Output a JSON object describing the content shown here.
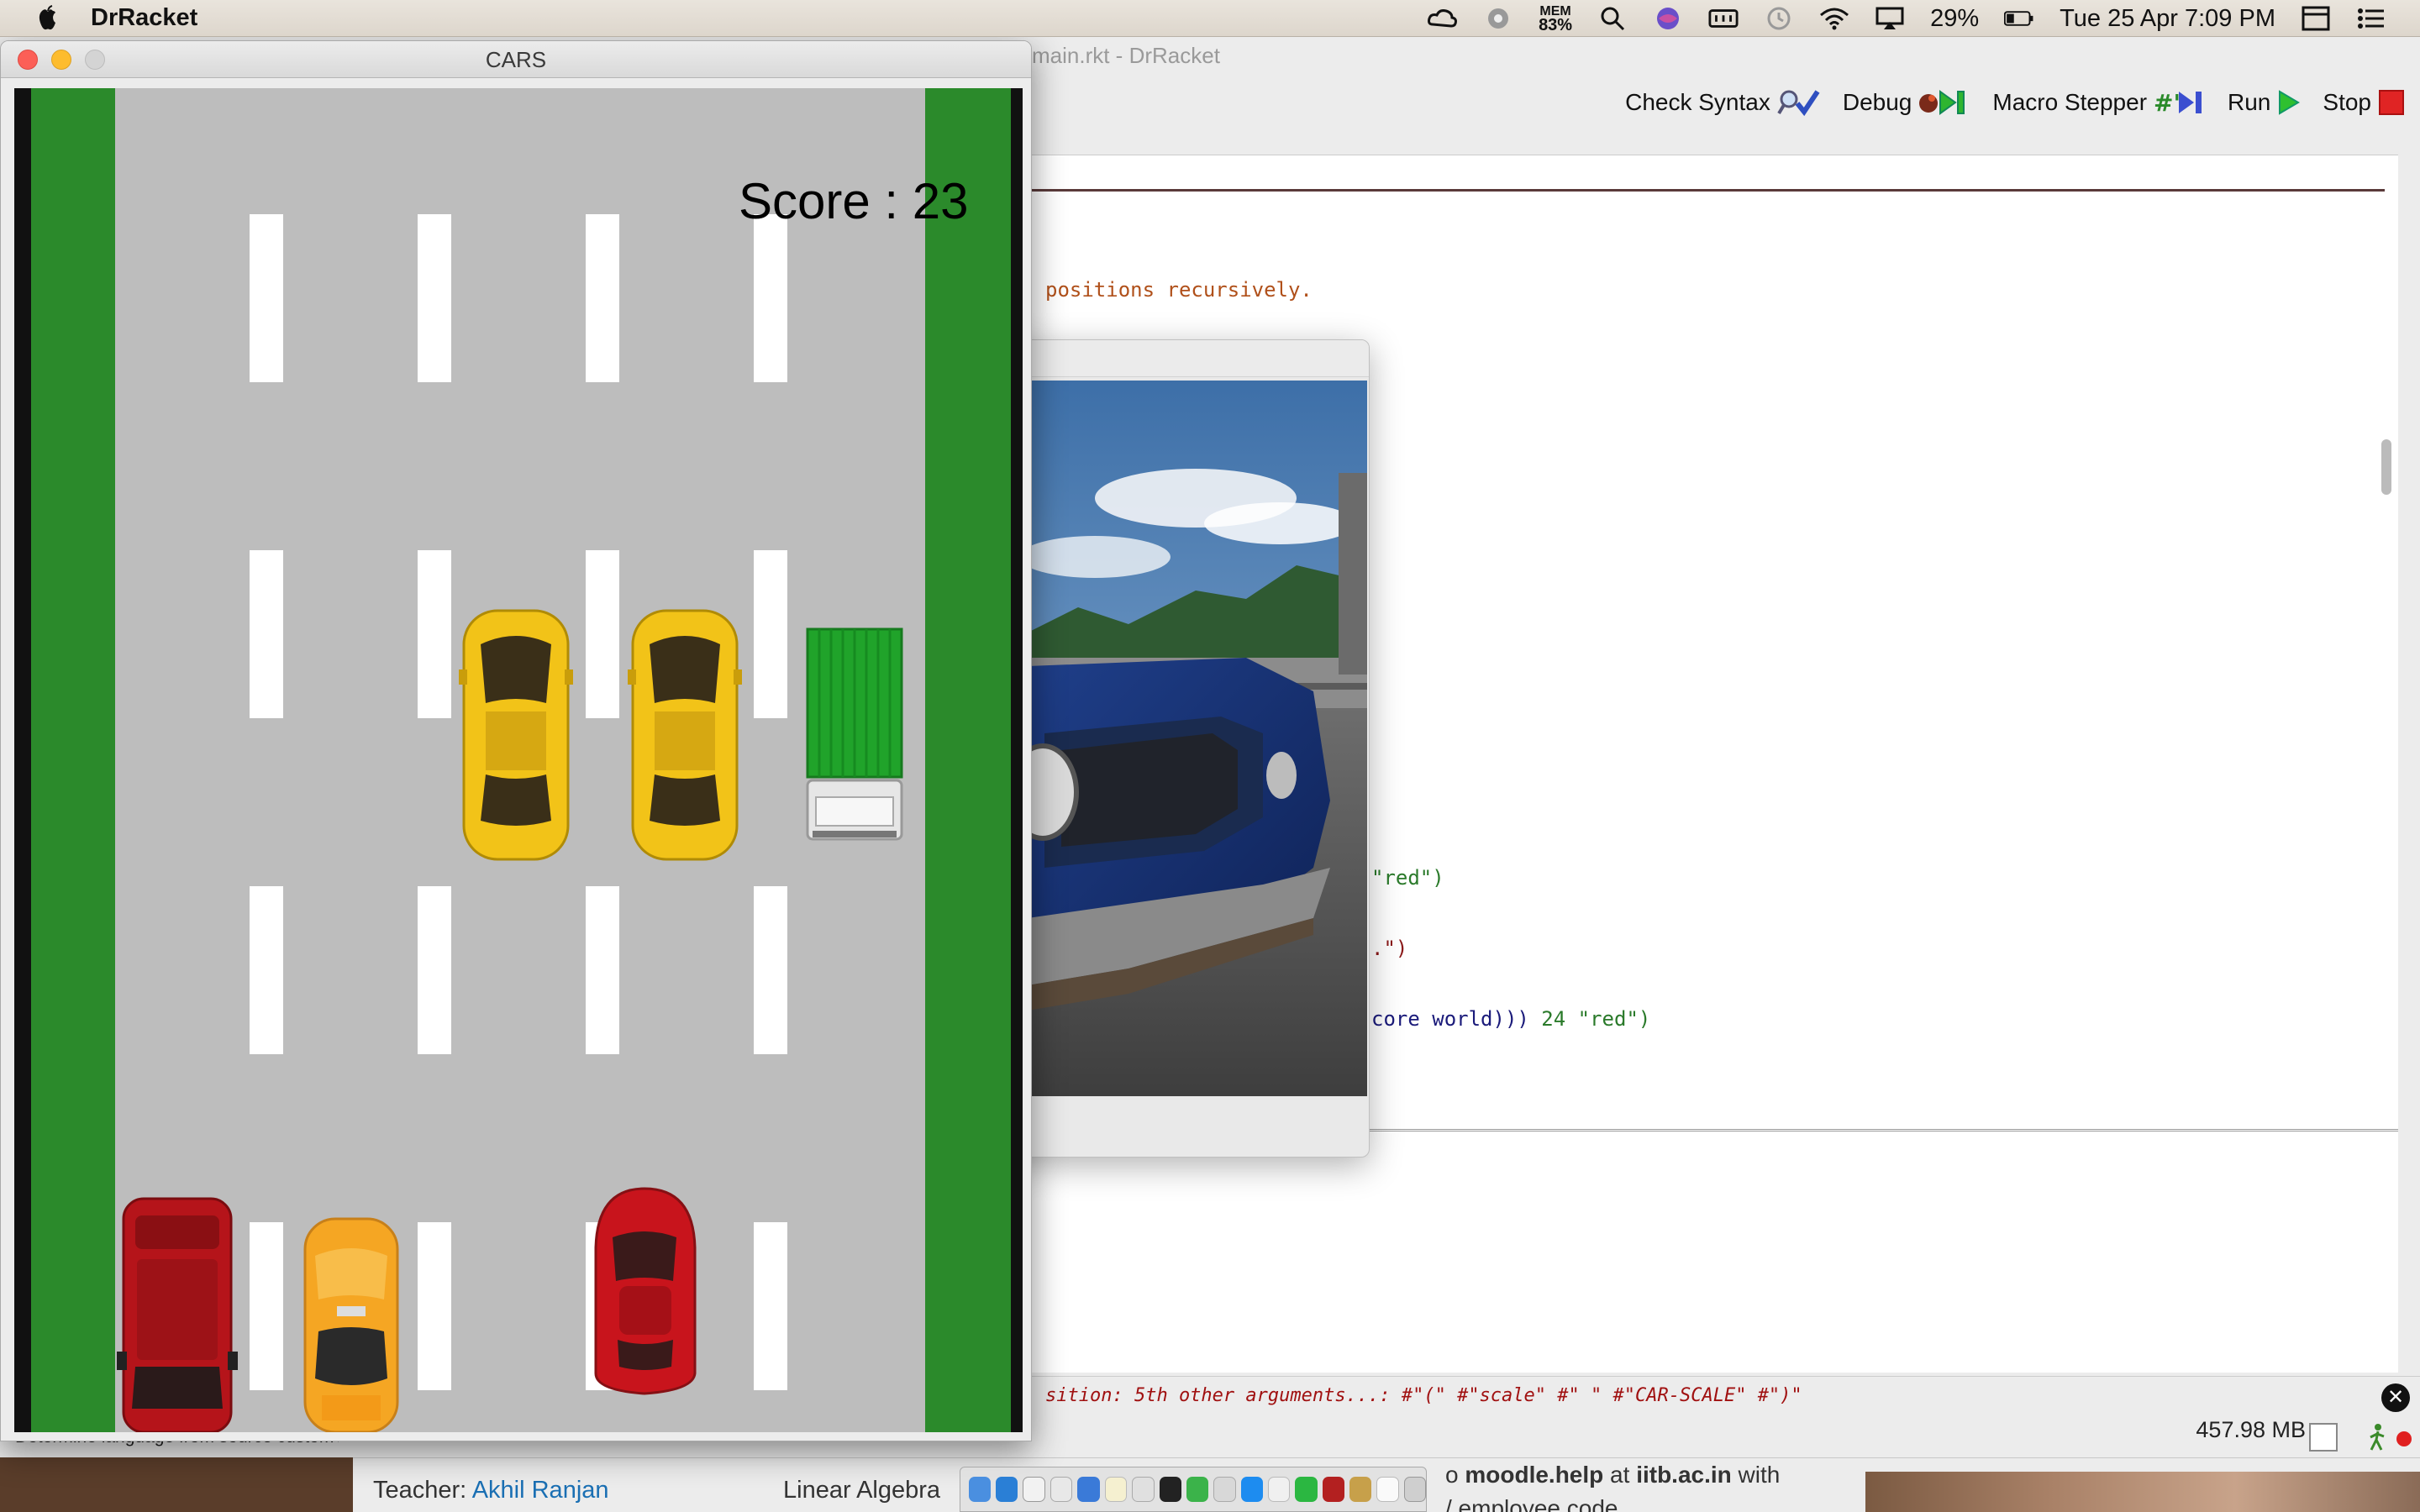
{
  "menubar": {
    "app_name": "DrRacket",
    "mem_label": "MEM",
    "mem_value": "83%",
    "battery": "29%",
    "clock": "Tue 25 Apr  7:09 PM"
  },
  "drracket": {
    "title": "main.rkt - DrRacket",
    "toolbar": {
      "check_syntax": "Check Syntax",
      "debug": "Debug",
      "macro_stepper": "Macro Stepper",
      "run": "Run",
      "stop": "Stop"
    },
    "code": {
      "comment": "positions recursively.",
      "line_a_str": "\"red\")",
      "line_b_str": ".\")",
      "line_c_code": "core world)))",
      "line_c_num": "24",
      "line_c_str": "\"red\")"
    },
    "error_message": "sition: 5th other arguments...: #\"(\" #\"scale\" #\" \" #\"CAR-SCALE\" #\")\"",
    "status": {
      "language": "Determine language from source custom",
      "memory": "457.98 MB"
    }
  },
  "game": {
    "window_title": "CARS",
    "score_label": "Score : 23",
    "colors": {
      "grass": "#2b8a2b",
      "road": "#bdbdbd",
      "yellow_car": "#f2c318",
      "red_car": "#c8141c",
      "truck": "#20a32a"
    }
  },
  "background_page": {
    "teacher_label": "Teacher:",
    "teacher_name": "Akhil Ranjan",
    "course": "Linear Algebra",
    "help_prefix": "o ",
    "help_strong": "moodle.help",
    "help_at": " at ",
    "help_domain": "iitb.ac.in",
    "help_suffix": " with",
    "help_line2": "/ employee code"
  }
}
